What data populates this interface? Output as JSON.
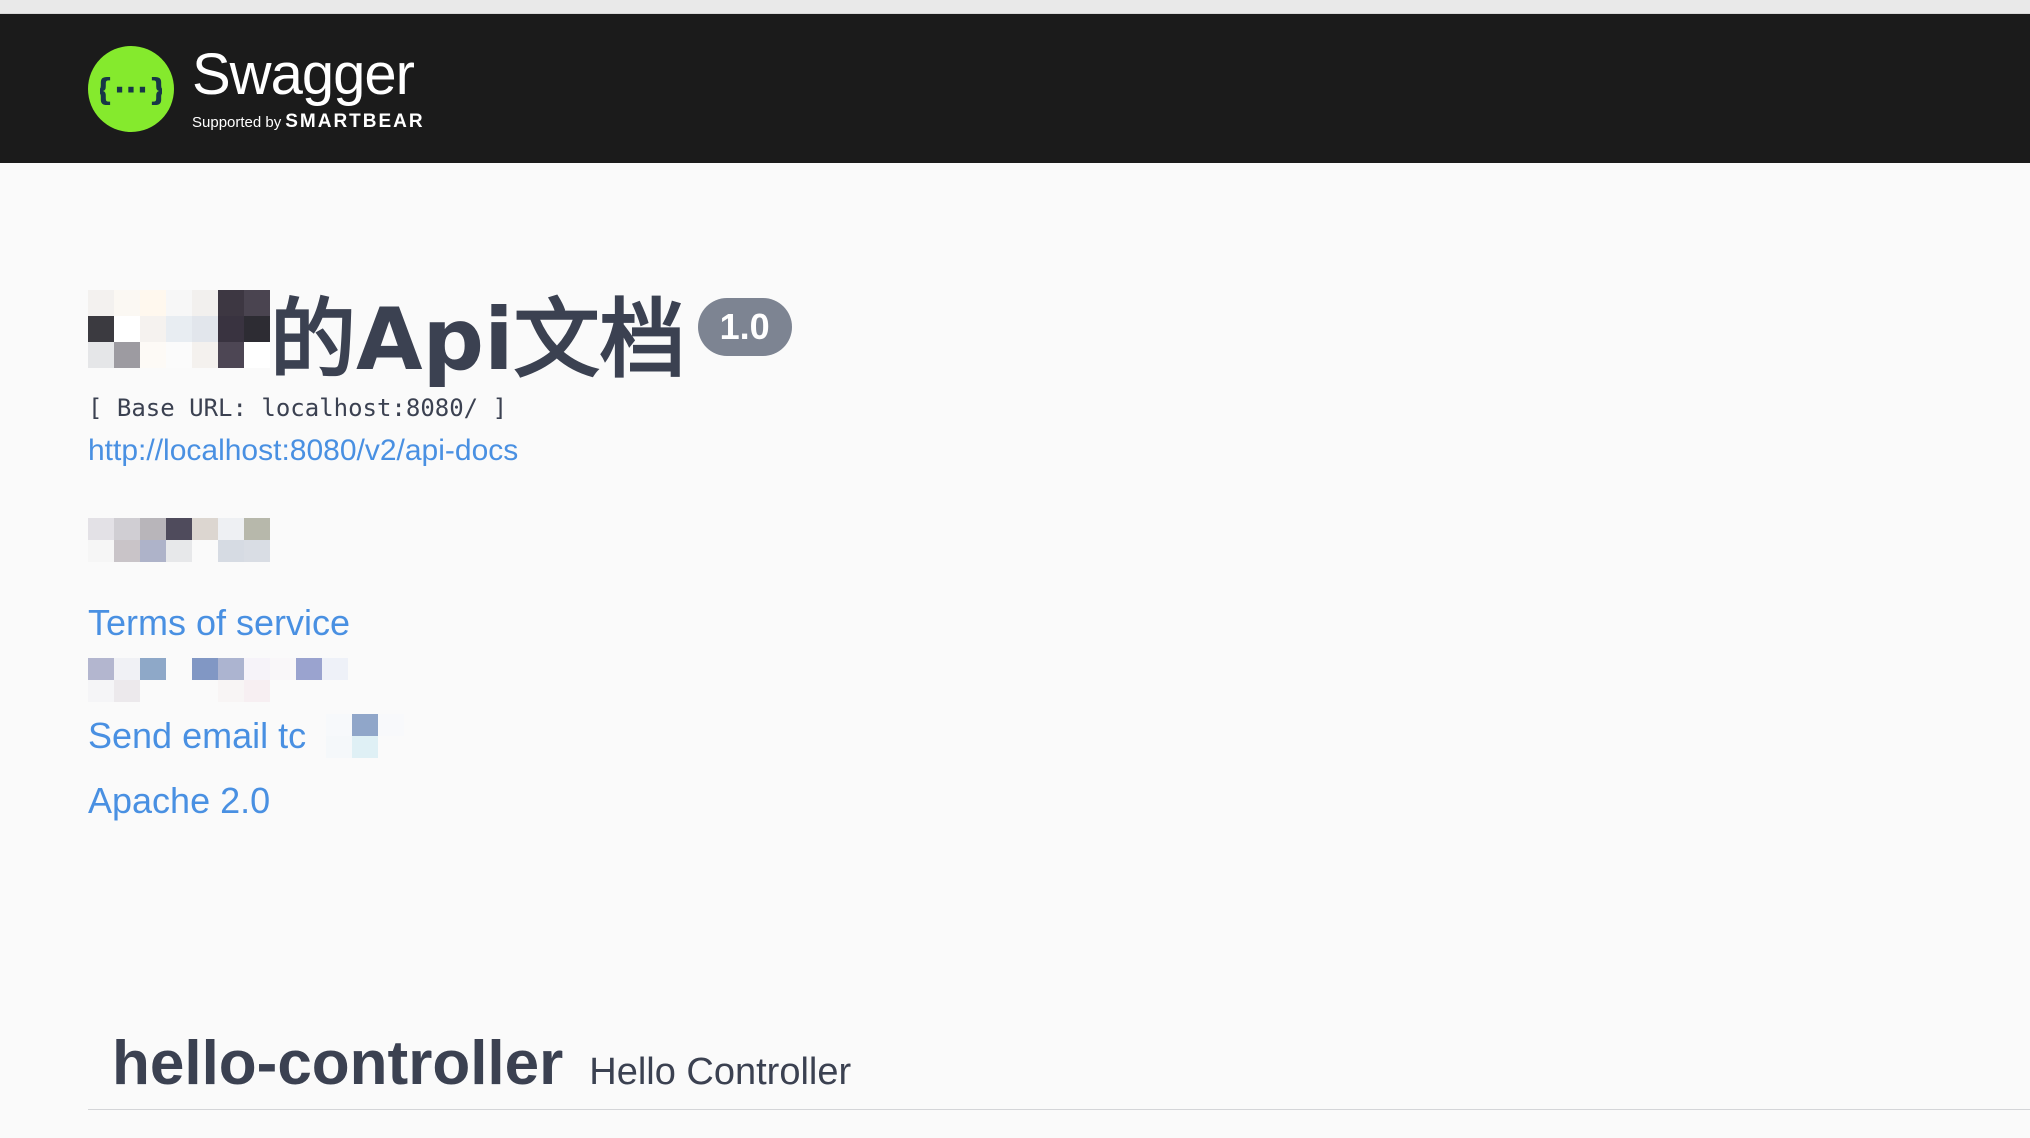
{
  "topbar": {
    "logo_title": "Swagger",
    "logo_supported": "Supported by",
    "logo_brand": "SMARTBEAR",
    "icon": "swagger-braces-icon",
    "accent": "#85ea2d"
  },
  "info": {
    "title": "的Api文档",
    "version": "1.0",
    "base_url": "[ Base URL: localhost:8080/ ]",
    "docs_link": "http://localhost:8080/v2/api-docs",
    "terms_link": "Terms of service",
    "email_link": "Send email tc",
    "license_link": "Apache 2.0"
  },
  "tags": [
    {
      "name": "hello-controller",
      "description": "Hello Controller"
    }
  ],
  "colors": {
    "link": "#4990e2",
    "text": "#3b4151",
    "topbar_bg": "#1b1b1b"
  }
}
